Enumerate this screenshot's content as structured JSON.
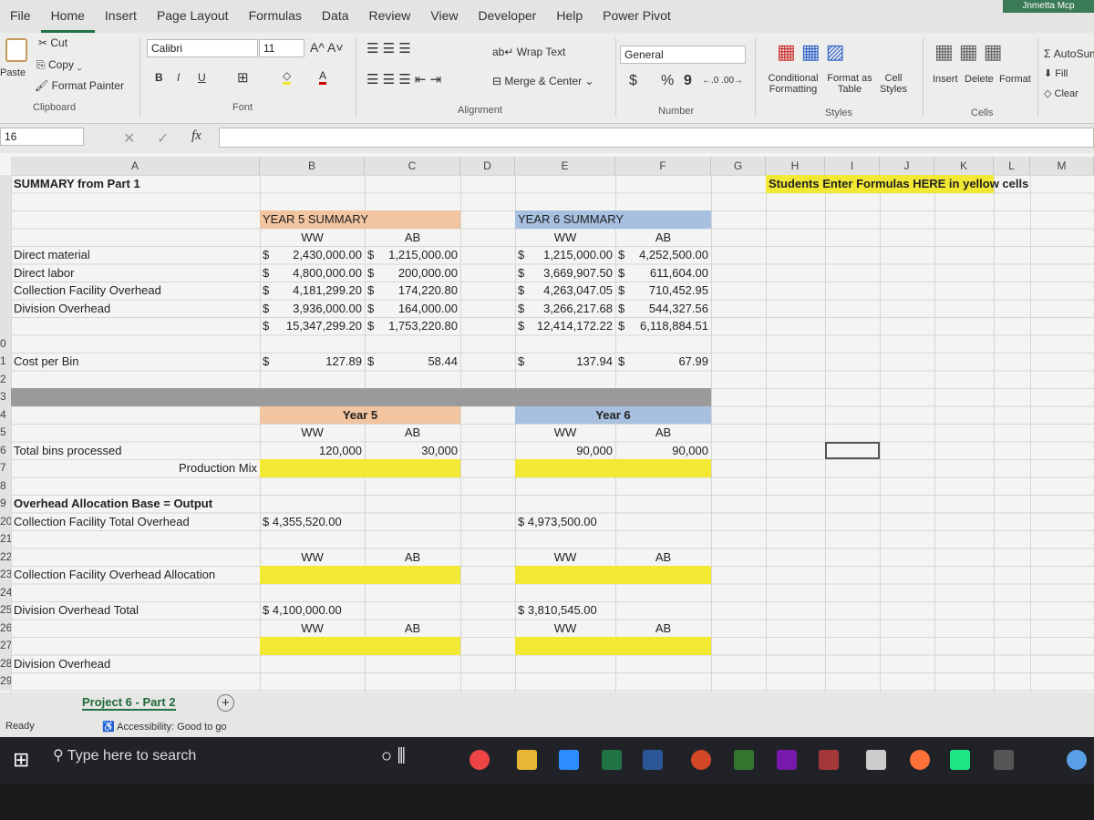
{
  "window": {
    "user": "Jnmetta Mcp"
  },
  "ribbon_tabs": [
    "File",
    "Home",
    "Insert",
    "Page Layout",
    "Formulas",
    "Data",
    "Review",
    "View",
    "Developer",
    "Help",
    "Power Pivot"
  ],
  "active_tab": "Home",
  "clipboard": {
    "paste": "Paste",
    "cut": "Cut",
    "copy": "Copy",
    "format_painter": "Format Painter",
    "label": "Clipboard"
  },
  "font": {
    "name": "Calibri",
    "size": "11",
    "bold": "B",
    "italic": "I",
    "underline": "U",
    "label": "Font"
  },
  "alignment": {
    "wrap": "Wrap Text",
    "merge": "Merge & Center",
    "label": "Alignment"
  },
  "number": {
    "format": "General",
    "currency": "$",
    "percent": "%",
    "comma": "9",
    "label": "Number"
  },
  "styles": {
    "conditional": "Conditional Formatting",
    "format_table": "Format as Table",
    "cell_styles": "Cell Styles",
    "label": "Styles"
  },
  "cells": {
    "insert": "Insert",
    "delete": "Delete",
    "format": "Format",
    "label": "Cells"
  },
  "editing": {
    "autosum": "AutoSum",
    "fill": "Fill",
    "clear": "Clear"
  },
  "formula_bar": {
    "name_box": "16",
    "fx": "fx",
    "value": ""
  },
  "columns": [
    "A",
    "B",
    "C",
    "D",
    "E",
    "F",
    "G",
    "H",
    "I",
    "J",
    "K",
    "L",
    "M"
  ],
  "rows": [
    "",
    "",
    "",
    "",
    "",
    "",
    "",
    "",
    "",
    "0",
    "1",
    "2",
    "3",
    "4",
    "5",
    "6",
    "7",
    "8",
    "9",
    "20",
    "21",
    "22",
    "23",
    "24",
    "25",
    "26",
    "27",
    "28",
    "29"
  ],
  "sheet_cells": [
    {
      "ref": "A1",
      "v": "SUMMARY from Part 1",
      "bold": true
    },
    {
      "ref": "H1",
      "v": "Students Enter Formulas HERE in yellow cells",
      "bold": true
    },
    {
      "ref": "B3",
      "v": "YEAR 5 SUMMARY",
      "center": true
    },
    {
      "ref": "E3",
      "v": "YEAR 6 SUMMARY",
      "center": true
    },
    {
      "ref": "B4",
      "v": "WW",
      "center": true
    },
    {
      "ref": "C4",
      "v": "AB",
      "center": true
    },
    {
      "ref": "E4",
      "v": "WW",
      "center": true
    },
    {
      "ref": "F4",
      "v": "AB",
      "center": true
    },
    {
      "ref": "A5",
      "v": "Direct material"
    },
    {
      "ref": "B5",
      "v": "$ 2,430,000.00"
    },
    {
      "ref": "C5",
      "v": "$ 1,215,000.00"
    },
    {
      "ref": "E5",
      "v": "$ 1,215,000.00"
    },
    {
      "ref": "F5",
      "v": "$ 4,252,500.00"
    },
    {
      "ref": "A6",
      "v": "Direct labor"
    },
    {
      "ref": "B6",
      "v": "$ 4,800,000.00"
    },
    {
      "ref": "C6",
      "v": "$ 200,000.00"
    },
    {
      "ref": "E6",
      "v": "$ 3,669,907.50"
    },
    {
      "ref": "F6",
      "v": "$ 611,604.00"
    },
    {
      "ref": "A7",
      "v": "Collection Facility Overhead"
    },
    {
      "ref": "B7",
      "v": "$ 4,181,299.20"
    },
    {
      "ref": "C7",
      "v": "$ 174,220.80"
    },
    {
      "ref": "E7",
      "v": "$ 4,263,047.05"
    },
    {
      "ref": "F7",
      "v": "$ 710,452.95"
    },
    {
      "ref": "A8",
      "v": "Division Overhead"
    },
    {
      "ref": "B8",
      "v": "$ 3,936,000.00"
    },
    {
      "ref": "C8",
      "v": "$ 164,000.00"
    },
    {
      "ref": "E8",
      "v": "$ 3,266,217.68"
    },
    {
      "ref": "F8",
      "v": "$ 544,327.56"
    },
    {
      "ref": "B9",
      "v": "$ 15,347,299.20"
    },
    {
      "ref": "C9",
      "v": "$ 1,753,220.80"
    },
    {
      "ref": "E9",
      "v": "$ 12,414,172.22"
    },
    {
      "ref": "F9",
      "v": "$ 6,118,884.51"
    },
    {
      "ref": "A11",
      "v": "Cost per Bin"
    },
    {
      "ref": "B11",
      "v": "$ 127.89"
    },
    {
      "ref": "C11",
      "v": "$ 58.44"
    },
    {
      "ref": "E11",
      "v": "$ 137.94"
    },
    {
      "ref": "F11",
      "v": "$ 67.99"
    },
    {
      "ref": "B14",
      "v": "Year 5",
      "span": true,
      "bold": true
    },
    {
      "ref": "E14",
      "v": "Year 6",
      "span": true,
      "bold": true
    },
    {
      "ref": "B15",
      "v": "WW",
      "center": true
    },
    {
      "ref": "C15",
      "v": "AB",
      "center": true
    },
    {
      "ref": "E15",
      "v": "WW",
      "center": true
    },
    {
      "ref": "F15",
      "v": "AB",
      "center": true
    },
    {
      "ref": "A16",
      "v": "Total bins processed"
    },
    {
      "ref": "B16",
      "v": "120,000",
      "right": true
    },
    {
      "ref": "C16",
      "v": "30,000",
      "right": true
    },
    {
      "ref": "E16",
      "v": "90,000",
      "right": true
    },
    {
      "ref": "F16",
      "v": "90,000",
      "right": true
    },
    {
      "ref": "A17",
      "v": "Production Mix",
      "right": true
    },
    {
      "ref": "A19",
      "v": "Overhead Allocation Base = Output",
      "bold": true
    },
    {
      "ref": "A20",
      "v": "Collection Facility Total Overhead"
    },
    {
      "ref": "B20",
      "v": "$ 4,355,520.00",
      "left": true
    },
    {
      "ref": "E20",
      "v": "$ 4,973,500.00",
      "left": true
    },
    {
      "ref": "B22",
      "v": "WW",
      "center": true
    },
    {
      "ref": "C22",
      "v": "AB",
      "center": true
    },
    {
      "ref": "E22",
      "v": "WW",
      "center": true
    },
    {
      "ref": "F22",
      "v": "AB",
      "center": true
    },
    {
      "ref": "A23",
      "v": "Collection Facility Overhead Allocation"
    },
    {
      "ref": "A25",
      "v": "Division Overhead Total"
    },
    {
      "ref": "B25",
      "v": "$ 4,100,000.00",
      "left": true
    },
    {
      "ref": "E25",
      "v": "$ 3,810,545.00",
      "left": true
    },
    {
      "ref": "B26",
      "v": "WW",
      "center": true
    },
    {
      "ref": "C26",
      "v": "AB",
      "center": true
    },
    {
      "ref": "E26",
      "v": "WW",
      "center": true
    },
    {
      "ref": "F26",
      "v": "AB",
      "center": true
    },
    {
      "ref": "A28",
      "v": "Division Overhead"
    }
  ],
  "sheet_tab": "Project 6 - Part 2",
  "status": {
    "ready": "Ready",
    "accessibility": "Accessibility: Good to go"
  },
  "taskbar": {
    "search_placeholder": "Type here to search"
  },
  "colors": {
    "accent": "#217346",
    "yellow": "#f3e833",
    "orange": "#f2c4a0",
    "blue": "#a7c0e0",
    "gray": "#9a9a9a"
  }
}
